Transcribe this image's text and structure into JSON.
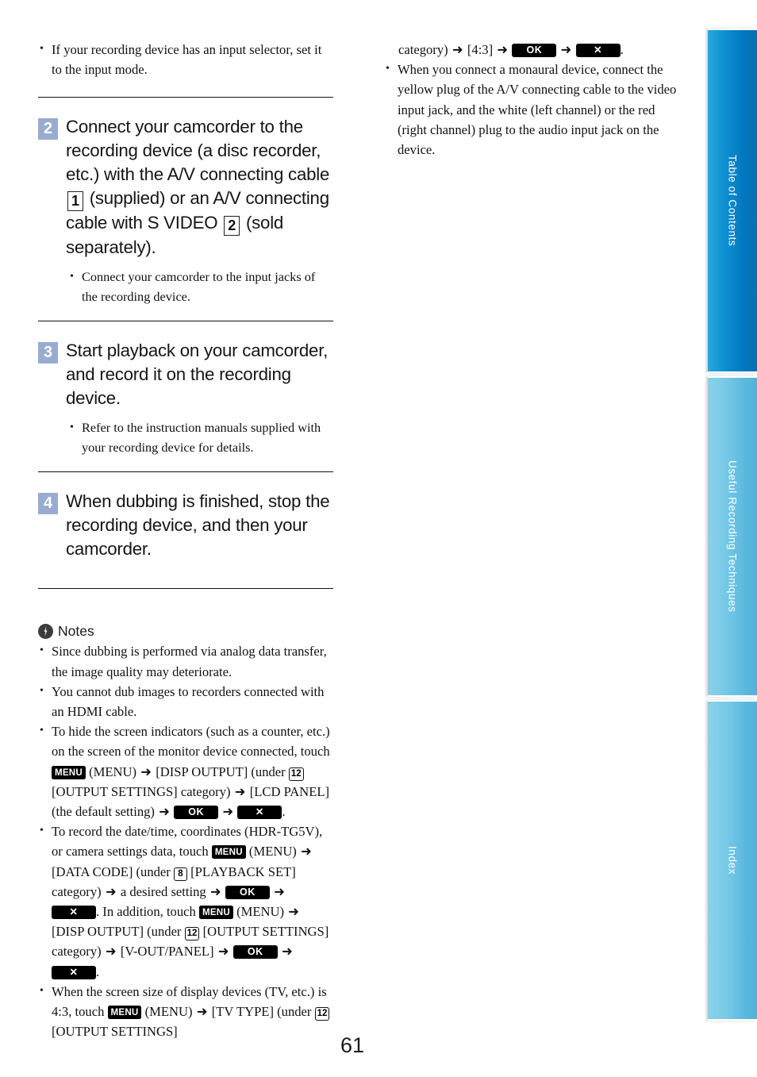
{
  "page": {
    "number": "61"
  },
  "left_column": {
    "intro_bullets": [
      "If your recording device has an input selector, set it to the input mode."
    ],
    "steps": [
      {
        "number": "2",
        "text_part1": "Connect your camcorder to the recording device (a disc recorder, etc.) with the A/V connecting cable",
        "boxnum1": "1",
        "text_part2": "(supplied) or an A/V connecting cable with S VIDEO",
        "boxnum2": "2",
        "text_part3": "(sold separately).",
        "substeps": [
          "Connect your camcorder to the input jacks of the recording device."
        ]
      },
      {
        "number": "3",
        "text": "Start playback on your camcorder, and record it on the recording device.",
        "substeps": [
          "Refer to the instruction manuals supplied with your recording device for details."
        ]
      },
      {
        "number": "4",
        "text": "When dubbing is finished, stop the recording device, and then your camcorder.",
        "substeps": []
      }
    ],
    "notes": {
      "icon": "flash-circle-icon",
      "title": "Notes",
      "items": {
        "item1": "Since dubbing is performed via analog data transfer, the image quality may deteriorate.",
        "item2": "You cannot dub images to recorders connected with an HDMI cable.",
        "item3": {
          "t1": "To hide the screen indicators (such as a counter, etc.) on the screen of the monitor device connected, touch",
          "menu_glyph": "MENU",
          "t2": "(MENU)",
          "t3": "[DISP OUTPUT] (under",
          "cat12": "12",
          "t4": "[OUTPUT SETTINGS] category)",
          "t5": "[LCD PANEL] (the default setting)",
          "ok": "OK",
          "close": "✕",
          "t6": "."
        },
        "item4": {
          "t1": "To record the date/time, coordinates (HDR-TG5V), or camera settings data, touch",
          "menu_glyph": "MENU",
          "t2": "(MENU)",
          "t3": "[DATA CODE] (under",
          "cat8": "8",
          "t4": "[PLAYBACK SET] category)",
          "t5": "a desired setting",
          "ok": "OK",
          "close": "✕",
          "t6": ". In addition, touch",
          "menu_glyph2": "MENU",
          "t7": "(MENU)",
          "t8": "[DISP OUTPUT] (under",
          "cat12": "12",
          "t9": "[OUTPUT SETTINGS] category)",
          "t10": "[V-OUT/PANEL]",
          "ok2": "OK",
          "close2": "✕",
          "t11": "."
        },
        "item5": {
          "t1": "When the screen size of display devices (TV, etc.) is 4:3, touch",
          "menu_glyph": "MENU",
          "t2": "(MENU)",
          "t3": "[TV TYPE] (under",
          "cat12": "12",
          "t4": "[OUTPUT SETTINGS]"
        }
      }
    }
  },
  "right_column": {
    "continued_line": {
      "t1": "category)",
      "t2": "[4:3]",
      "ok": "OK",
      "close": "✕",
      "t3": "."
    },
    "bullets": [
      "When you connect a monaural device, connect the yellow plug of the A/V connecting cable to the video input jack, and the white (left channel) or the red (right channel) plug to the audio input jack on the device."
    ]
  },
  "sidebar": {
    "tabs": [
      {
        "id": "table-of-contents",
        "label": "Table of Contents",
        "color": "#0d8fd0",
        "active": true
      },
      {
        "id": "useful-recording-techniques",
        "label": "Useful Recording Techniques",
        "color": "#73c7e6",
        "active": false
      },
      {
        "id": "index",
        "label": "Index",
        "color": "#76c9e7",
        "active": false
      }
    ]
  },
  "symbols": {
    "arrow": "➜"
  }
}
